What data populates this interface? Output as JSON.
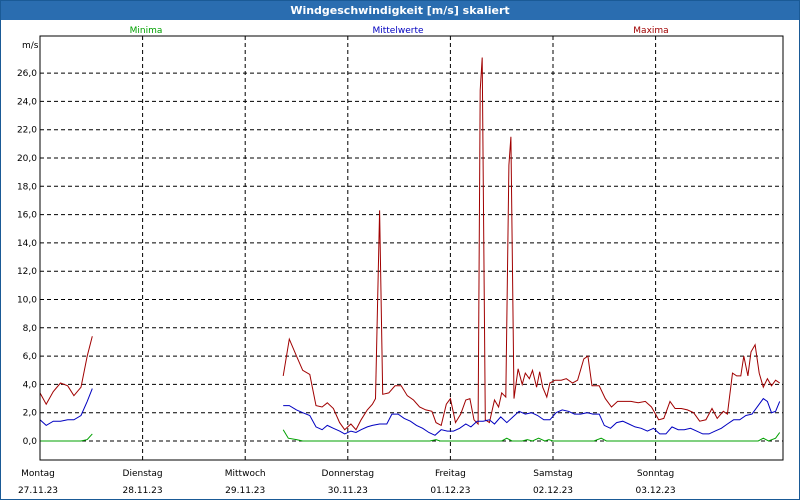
{
  "window": {
    "title": "Windgeschwindigkeit [m/s] skaliert"
  },
  "legend": [
    {
      "label": "Minima",
      "color": "#00a000"
    },
    {
      "label": "Mittelwerte",
      "color": "#0000c0"
    },
    {
      "label": "Maxima",
      "color": "#a00000"
    }
  ],
  "chart_data": {
    "type": "line",
    "title": "Windgeschwindigkeit [m/s] skaliert",
    "ylabel": "m/s",
    "xlabel": "",
    "ylim": [
      0,
      28
    ],
    "yticks": [
      "0,0",
      "2,0",
      "4,0",
      "6,0",
      "8,0",
      "10,0",
      "12,0",
      "14,0",
      "16,0",
      "18,0",
      "20,0",
      "22,0",
      "24,0",
      "26,0"
    ],
    "ytick_values": [
      0,
      2,
      4,
      6,
      8,
      10,
      12,
      14,
      16,
      18,
      20,
      22,
      24,
      26
    ],
    "grid": true,
    "legend_position": "top",
    "xlim": [
      0,
      7
    ],
    "x_ticks": [
      {
        "day": "Montag",
        "date": "27.11.23"
      },
      {
        "day": "Dienstag",
        "date": "28.11.23"
      },
      {
        "day": "Mittwoch",
        "date": "29.11.23"
      },
      {
        "day": "Donnerstag",
        "date": "30.11.23"
      },
      {
        "day": "Freitag",
        "date": "01.12.23"
      },
      {
        "day": "Samstag",
        "date": "02.12.23"
      },
      {
        "day": "Sonntag",
        "date": "03.12.23"
      }
    ],
    "series": [
      {
        "name": "Maxima",
        "color": "#a00000",
        "segments": [
          [
            [
              0.0,
              3.4
            ],
            [
              0.06,
              2.6
            ],
            [
              0.13,
              3.5
            ],
            [
              0.2,
              4.1
            ],
            [
              0.27,
              3.9
            ],
            [
              0.33,
              3.2
            ],
            [
              0.4,
              3.8
            ],
            [
              0.46,
              6.0
            ],
            [
              0.51,
              7.4
            ]
          ],
          [
            [
              2.37,
              4.6
            ],
            [
              2.43,
              7.2
            ],
            [
              2.5,
              6.0
            ],
            [
              2.56,
              5.0
            ],
            [
              2.63,
              4.7
            ],
            [
              2.69,
              2.5
            ],
            [
              2.75,
              2.4
            ],
            [
              2.8,
              2.7
            ],
            [
              2.86,
              2.3
            ],
            [
              2.92,
              1.3
            ],
            [
              2.97,
              0.8
            ],
            [
              3.03,
              1.2
            ],
            [
              3.08,
              0.8
            ],
            [
              3.13,
              1.5
            ],
            [
              3.19,
              2.2
            ],
            [
              3.24,
              2.6
            ],
            [
              3.27,
              3.0
            ],
            [
              3.31,
              16.3
            ],
            [
              3.34,
              3.3
            ],
            [
              3.4,
              3.4
            ],
            [
              3.46,
              3.9
            ],
            [
              3.52,
              3.9
            ],
            [
              3.58,
              3.2
            ],
            [
              3.64,
              2.9
            ],
            [
              3.7,
              2.4
            ],
            [
              3.76,
              2.2
            ],
            [
              3.82,
              2.1
            ],
            [
              3.86,
              1.3
            ],
            [
              3.91,
              1.1
            ],
            [
              3.96,
              2.6
            ],
            [
              4.0,
              3.0
            ],
            [
              4.05,
              1.3
            ],
            [
              4.1,
              1.9
            ],
            [
              4.15,
              2.9
            ],
            [
              4.19,
              3.0
            ],
            [
              4.23,
              1.5
            ],
            [
              4.27,
              1.2
            ],
            [
              4.29,
              24.8
            ],
            [
              4.31,
              27.1
            ],
            [
              4.34,
              1.5
            ],
            [
              4.38,
              1.3
            ],
            [
              4.43,
              2.9
            ],
            [
              4.47,
              2.4
            ],
            [
              4.5,
              3.4
            ],
            [
              4.54,
              3.1
            ],
            [
              4.57,
              19.5
            ],
            [
              4.59,
              21.5
            ],
            [
              4.62,
              3.0
            ],
            [
              4.66,
              5.1
            ],
            [
              4.7,
              4.0
            ],
            [
              4.73,
              4.8
            ],
            [
              4.77,
              4.4
            ],
            [
              4.8,
              5.0
            ],
            [
              4.84,
              3.8
            ],
            [
              4.87,
              4.9
            ],
            [
              4.9,
              3.8
            ],
            [
              4.94,
              3.1
            ],
            [
              4.97,
              4.1
            ],
            [
              5.02,
              4.3
            ],
            [
              5.08,
              4.3
            ],
            [
              5.13,
              4.4
            ],
            [
              5.19,
              4.1
            ],
            [
              5.24,
              4.3
            ],
            [
              5.3,
              5.8
            ],
            [
              5.34,
              6.0
            ],
            [
              5.38,
              3.9
            ],
            [
              5.45,
              3.9
            ],
            [
              5.51,
              3.0
            ],
            [
              5.57,
              2.4
            ],
            [
              5.63,
              2.8
            ],
            [
              5.7,
              2.8
            ],
            [
              5.76,
              2.8
            ],
            [
              5.83,
              2.7
            ],
            [
              5.9,
              2.8
            ],
            [
              5.96,
              2.4
            ],
            [
              6.03,
              1.5
            ],
            [
              6.08,
              1.6
            ],
            [
              6.14,
              2.8
            ],
            [
              6.19,
              2.3
            ],
            [
              6.25,
              2.3
            ],
            [
              6.31,
              2.2
            ],
            [
              6.37,
              2.0
            ],
            [
              6.43,
              1.4
            ],
            [
              6.49,
              1.5
            ],
            [
              6.55,
              2.3
            ],
            [
              6.6,
              1.6
            ],
            [
              6.66,
              2.1
            ],
            [
              6.7,
              1.9
            ],
            [
              6.75,
              4.8
            ],
            [
              6.79,
              4.6
            ],
            [
              6.83,
              4.6
            ],
            [
              6.86,
              6.0
            ],
            [
              6.9,
              4.6
            ],
            [
              6.93,
              6.3
            ],
            [
              6.97,
              6.8
            ],
            [
              7.01,
              4.8
            ],
            [
              7.05,
              3.8
            ],
            [
              7.09,
              4.4
            ],
            [
              7.13,
              3.9
            ],
            [
              7.17,
              4.3
            ],
            [
              7.21,
              4.1
            ]
          ]
        ]
      },
      {
        "name": "Mittelwerte",
        "color": "#0000c0",
        "segments": [
          [
            [
              0.0,
              1.5
            ],
            [
              0.06,
              1.1
            ],
            [
              0.13,
              1.4
            ],
            [
              0.2,
              1.4
            ],
            [
              0.27,
              1.5
            ],
            [
              0.33,
              1.5
            ],
            [
              0.4,
              1.8
            ],
            [
              0.46,
              2.8
            ],
            [
              0.51,
              3.7
            ]
          ],
          [
            [
              2.37,
              2.5
            ],
            [
              2.43,
              2.5
            ],
            [
              2.5,
              2.2
            ],
            [
              2.56,
              2.0
            ],
            [
              2.63,
              1.8
            ],
            [
              2.69,
              1.0
            ],
            [
              2.75,
              0.8
            ],
            [
              2.8,
              1.1
            ],
            [
              2.86,
              0.9
            ],
            [
              2.92,
              0.7
            ],
            [
              2.97,
              0.5
            ],
            [
              3.03,
              0.7
            ],
            [
              3.08,
              0.6
            ],
            [
              3.13,
              0.8
            ],
            [
              3.19,
              1.0
            ],
            [
              3.24,
              1.1
            ],
            [
              3.31,
              1.2
            ],
            [
              3.38,
              1.2
            ],
            [
              3.43,
              1.9
            ],
            [
              3.49,
              1.9
            ],
            [
              3.55,
              1.6
            ],
            [
              3.61,
              1.4
            ],
            [
              3.67,
              1.1
            ],
            [
              3.73,
              0.9
            ],
            [
              3.79,
              0.6
            ],
            [
              3.85,
              0.4
            ],
            [
              3.91,
              0.8
            ],
            [
              3.97,
              0.7
            ],
            [
              4.03,
              0.7
            ],
            [
              4.09,
              0.9
            ],
            [
              4.15,
              1.2
            ],
            [
              4.2,
              1.0
            ],
            [
              4.26,
              1.4
            ],
            [
              4.32,
              1.4
            ],
            [
              4.38,
              1.5
            ],
            [
              4.43,
              1.2
            ],
            [
              4.49,
              1.7
            ],
            [
              4.55,
              1.3
            ],
            [
              4.61,
              1.7
            ],
            [
              4.67,
              2.1
            ],
            [
              4.73,
              1.9
            ],
            [
              4.79,
              2.0
            ],
            [
              4.85,
              1.8
            ],
            [
              4.91,
              1.5
            ],
            [
              4.97,
              1.5
            ],
            [
              5.03,
              2.0
            ],
            [
              5.09,
              2.2
            ],
            [
              5.15,
              2.1
            ],
            [
              5.21,
              1.9
            ],
            [
              5.27,
              1.9
            ],
            [
              5.33,
              2.0
            ],
            [
              5.39,
              1.9
            ],
            [
              5.45,
              1.9
            ],
            [
              5.5,
              1.1
            ],
            [
              5.56,
              0.9
            ],
            [
              5.62,
              1.3
            ],
            [
              5.68,
              1.4
            ],
            [
              5.74,
              1.2
            ],
            [
              5.8,
              1.0
            ],
            [
              5.86,
              0.9
            ],
            [
              5.92,
              0.7
            ],
            [
              5.98,
              0.9
            ],
            [
              6.04,
              0.5
            ],
            [
              6.1,
              0.5
            ],
            [
              6.16,
              1.0
            ],
            [
              6.22,
              0.8
            ],
            [
              6.28,
              0.8
            ],
            [
              6.34,
              0.9
            ],
            [
              6.4,
              0.7
            ],
            [
              6.46,
              0.5
            ],
            [
              6.52,
              0.5
            ],
            [
              6.58,
              0.7
            ],
            [
              6.64,
              0.9
            ],
            [
              6.7,
              1.2
            ],
            [
              6.76,
              1.5
            ],
            [
              6.82,
              1.5
            ],
            [
              6.88,
              1.8
            ],
            [
              6.94,
              1.9
            ],
            [
              7.0,
              2.5
            ],
            [
              7.05,
              3.0
            ],
            [
              7.09,
              2.8
            ],
            [
              7.13,
              2.0
            ],
            [
              7.17,
              2.1
            ],
            [
              7.21,
              2.8
            ]
          ]
        ]
      },
      {
        "name": "Minima",
        "color": "#00a000",
        "segments": [
          [
            [
              0.0,
              0.0
            ],
            [
              0.1,
              0.0
            ],
            [
              0.2,
              0.0
            ],
            [
              0.3,
              0.0
            ],
            [
              0.4,
              0.0
            ],
            [
              0.46,
              0.1
            ],
            [
              0.51,
              0.5
            ]
          ],
          [
            [
              2.37,
              0.8
            ],
            [
              2.42,
              0.2
            ],
            [
              2.5,
              0.1
            ],
            [
              2.56,
              0.0
            ],
            [
              2.7,
              0.0
            ],
            [
              2.9,
              0.0
            ],
            [
              3.1,
              0.0
            ],
            [
              3.3,
              0.0
            ],
            [
              3.5,
              0.0
            ],
            [
              3.7,
              0.0
            ],
            [
              3.8,
              0.0
            ],
            [
              3.86,
              0.1
            ],
            [
              3.9,
              0.0
            ],
            [
              4.1,
              0.0
            ],
            [
              4.3,
              0.0
            ],
            [
              4.5,
              0.0
            ],
            [
              4.55,
              0.2
            ],
            [
              4.6,
              0.0
            ],
            [
              4.7,
              0.0
            ],
            [
              4.75,
              0.1
            ],
            [
              4.8,
              0.0
            ],
            [
              4.86,
              0.2
            ],
            [
              4.92,
              0.0
            ],
            [
              4.96,
              0.1
            ],
            [
              5.0,
              0.0
            ],
            [
              5.2,
              0.0
            ],
            [
              5.4,
              0.0
            ],
            [
              5.47,
              0.2
            ],
            [
              5.52,
              0.0
            ],
            [
              5.7,
              0.0
            ],
            [
              5.9,
              0.0
            ],
            [
              6.1,
              0.0
            ],
            [
              6.3,
              0.0
            ],
            [
              6.5,
              0.0
            ],
            [
              6.7,
              0.0
            ],
            [
              6.9,
              0.0
            ],
            [
              7.0,
              0.0
            ],
            [
              7.05,
              0.2
            ],
            [
              7.1,
              0.0
            ],
            [
              7.17,
              0.2
            ],
            [
              7.21,
              0.6
            ]
          ]
        ]
      }
    ]
  }
}
